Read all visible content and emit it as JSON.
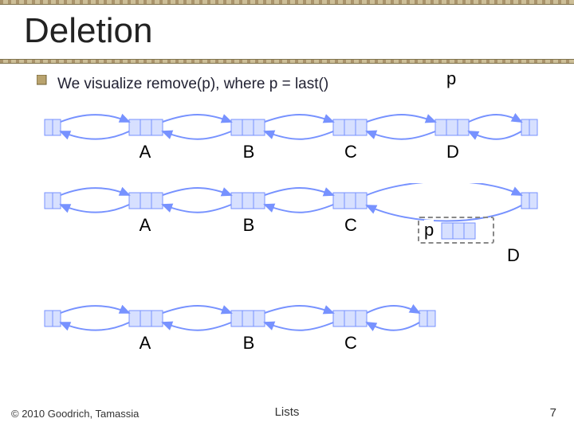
{
  "slide": {
    "title": "Deletion",
    "bullet": "We visualize remove(p), where p = last()",
    "footer_title": "Lists",
    "copyright": "© 2010 Goodrich, Tamassia",
    "page_num": "7"
  },
  "labels": {
    "p": "p",
    "A": "A",
    "B": "B",
    "C": "C",
    "D": "D"
  },
  "colors": {
    "accent_blue": "#7792ff",
    "accent_blue_light": "#d7e0ff",
    "link": "#9aa8c8"
  },
  "chart_data": [
    {
      "type": "diagram",
      "desc": "Initial doubly linked list with header+trailer and 4 nodes A,B,C,D; pointer p points at D (last())",
      "nodes": [
        "header",
        "A",
        "B",
        "C",
        "D",
        "trailer"
      ],
      "links_forward": [
        [
          "header",
          "A"
        ],
        [
          "A",
          "B"
        ],
        [
          "B",
          "C"
        ],
        [
          "C",
          "D"
        ],
        [
          "D",
          "trailer"
        ]
      ],
      "links_back": [
        [
          "trailer",
          "D"
        ],
        [
          "D",
          "C"
        ],
        [
          "C",
          "B"
        ],
        [
          "B",
          "A"
        ],
        [
          "A",
          "header"
        ]
      ],
      "pointer": {
        "name": "p",
        "target": "D"
      }
    },
    {
      "type": "diagram",
      "desc": "After unlinking D: C.next -> trailer, trailer.prev -> C; D shown detached below right with p pointing at it",
      "nodes": [
        "header",
        "A",
        "B",
        "C",
        "trailer"
      ],
      "detached": {
        "node": "D",
        "pointer": "p"
      },
      "links_forward": [
        [
          "header",
          "A"
        ],
        [
          "A",
          "B"
        ],
        [
          "B",
          "C"
        ],
        [
          "C",
          "trailer"
        ]
      ],
      "links_back": [
        [
          "trailer",
          "C"
        ],
        [
          "C",
          "B"
        ],
        [
          "B",
          "A"
        ],
        [
          "A",
          "header"
        ]
      ]
    },
    {
      "type": "diagram",
      "desc": "Final list: header, A, B, C, trailer",
      "nodes": [
        "header",
        "A",
        "B",
        "C",
        "trailer"
      ],
      "links_forward": [
        [
          "header",
          "A"
        ],
        [
          "A",
          "B"
        ],
        [
          "B",
          "C"
        ],
        [
          "C",
          "trailer"
        ]
      ],
      "links_back": [
        [
          "trailer",
          "C"
        ],
        [
          "C",
          "B"
        ],
        [
          "B",
          "A"
        ],
        [
          "A",
          "header"
        ]
      ]
    }
  ]
}
